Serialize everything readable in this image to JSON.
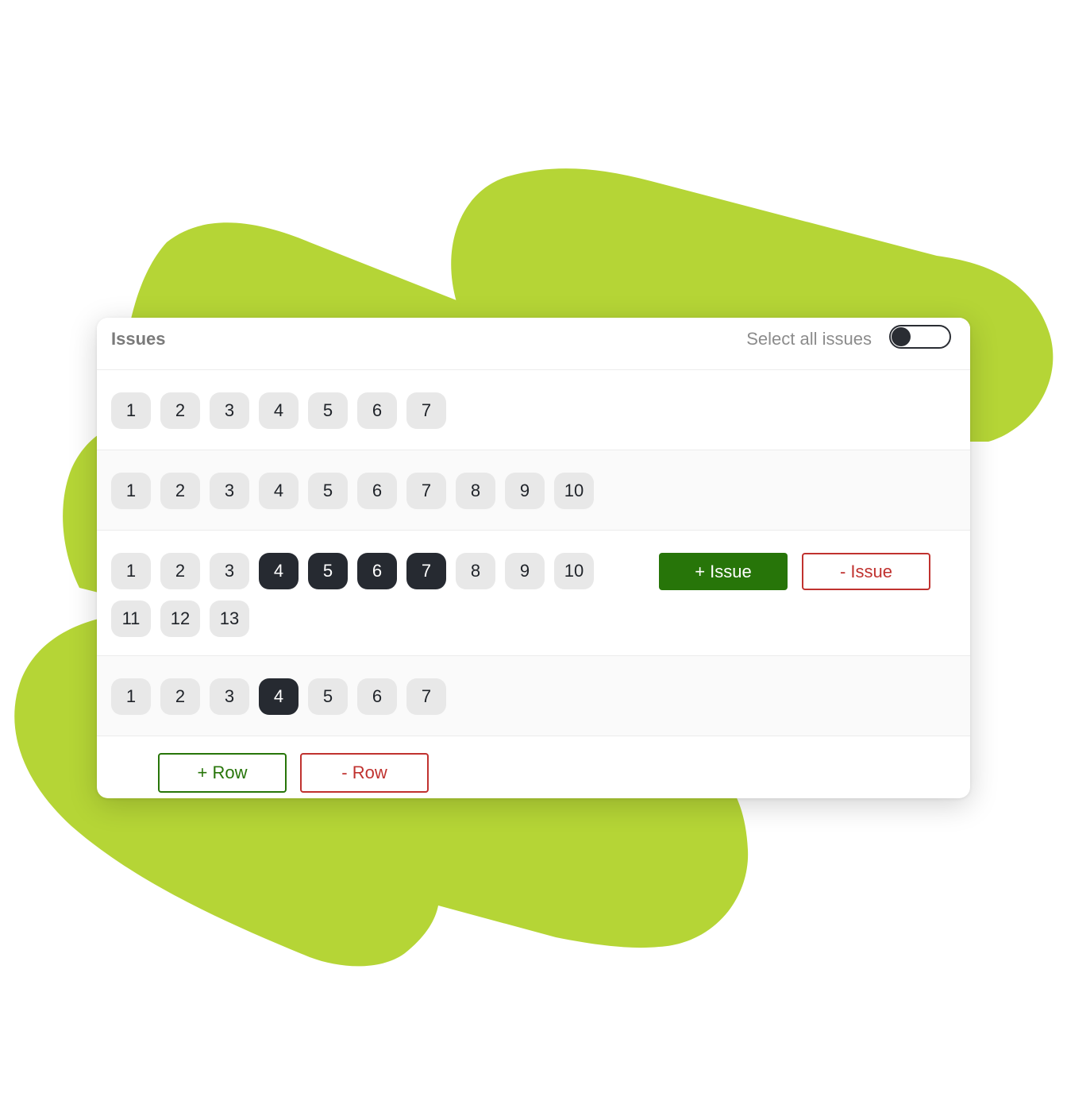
{
  "colors": {
    "accent_green": "#b5d536",
    "add_green": "#277509",
    "remove_red": "#c0322f",
    "selected_cell": "#262a31",
    "cell_bg": "#e8e8e8"
  },
  "header": {
    "title": "Issues",
    "select_all_label": "Select all issues",
    "select_all_on": false
  },
  "rows": [
    {
      "cells": [
        {
          "label": "1",
          "selected": false
        },
        {
          "label": "2",
          "selected": false
        },
        {
          "label": "3",
          "selected": false
        },
        {
          "label": "4",
          "selected": false
        },
        {
          "label": "5",
          "selected": false
        },
        {
          "label": "6",
          "selected": false
        },
        {
          "label": "7",
          "selected": false
        }
      ]
    },
    {
      "cells": [
        {
          "label": "1",
          "selected": false
        },
        {
          "label": "2",
          "selected": false
        },
        {
          "label": "3",
          "selected": false
        },
        {
          "label": "4",
          "selected": false
        },
        {
          "label": "5",
          "selected": false
        },
        {
          "label": "6",
          "selected": false
        },
        {
          "label": "7",
          "selected": false
        },
        {
          "label": "8",
          "selected": false
        },
        {
          "label": "9",
          "selected": false
        },
        {
          "label": "10",
          "selected": false
        }
      ]
    },
    {
      "cells": [
        {
          "label": "1",
          "selected": false
        },
        {
          "label": "2",
          "selected": false
        },
        {
          "label": "3",
          "selected": false
        },
        {
          "label": "4",
          "selected": true
        },
        {
          "label": "5",
          "selected": true
        },
        {
          "label": "6",
          "selected": true
        },
        {
          "label": "7",
          "selected": true
        },
        {
          "label": "8",
          "selected": false
        },
        {
          "label": "9",
          "selected": false
        },
        {
          "label": "10",
          "selected": false
        },
        {
          "label": "11",
          "selected": false
        },
        {
          "label": "12",
          "selected": false
        },
        {
          "label": "13",
          "selected": false
        }
      ]
    },
    {
      "cells": [
        {
          "label": "1",
          "selected": false
        },
        {
          "label": "2",
          "selected": false
        },
        {
          "label": "3",
          "selected": false
        },
        {
          "label": "4",
          "selected": true
        },
        {
          "label": "5",
          "selected": false
        },
        {
          "label": "6",
          "selected": false
        },
        {
          "label": "7",
          "selected": false
        }
      ]
    }
  ],
  "row_actions": {
    "add_issue": "+ Issue",
    "remove_issue": "- Issue"
  },
  "footer": {
    "add_row": "+ Row",
    "remove_row": "- Row"
  }
}
